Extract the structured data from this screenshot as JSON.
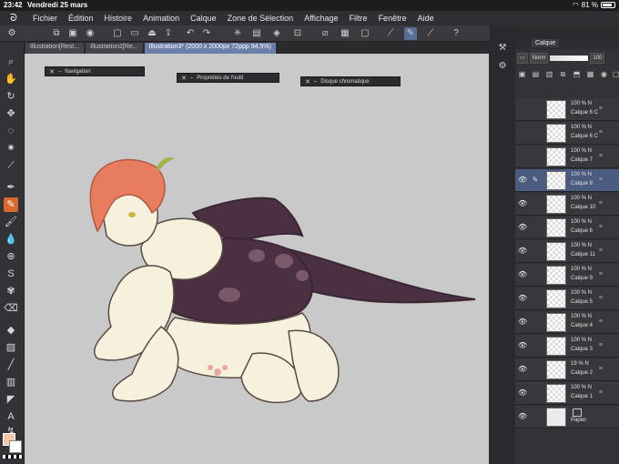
{
  "status": {
    "time": "23:42",
    "date": "Vendredi 25 mars",
    "battery": "81 %"
  },
  "menu": [
    "Fichier",
    "Édition",
    "Histoire",
    "Animation",
    "Calque",
    "Zone de Sélection",
    "Affichage",
    "Filtre",
    "Fenêtre",
    "Aide"
  ],
  "tabs": [
    {
      "label": "Illustration[Rest..."
    },
    {
      "label": "Illustration2[Re..."
    },
    {
      "label": "Illustration3* (2000 x 2000px 72ppp 94.5%)"
    }
  ],
  "palettes": {
    "navigation": "Navigation",
    "tool_props": "Propriétés de l'outil",
    "color_wheel": "Disque chromatique"
  },
  "layer_panel": {
    "tab": "Calque",
    "blend_mode": "Norm",
    "opacity": "100"
  },
  "layers": [
    {
      "opacity": "100 % N",
      "name": "Calque 6 C",
      "visible": false
    },
    {
      "opacity": "100 % N",
      "name": "Calque 6 C",
      "visible": false
    },
    {
      "opacity": "100 % N",
      "name": "Calque 7",
      "visible": false
    },
    {
      "opacity": "100 % N",
      "name": "Calque 8",
      "visible": true,
      "selected": true
    },
    {
      "opacity": "100 % N",
      "name": "Calque 10",
      "visible": true
    },
    {
      "opacity": "100 % N",
      "name": "Calque 6",
      "visible": true
    },
    {
      "opacity": "100 % N",
      "name": "Calque 11",
      "visible": true
    },
    {
      "opacity": "100 % N",
      "name": "Calque 9",
      "visible": true
    },
    {
      "opacity": "100 % N",
      "name": "Calque 5",
      "visible": true
    },
    {
      "opacity": "100 % N",
      "name": "Calque 4",
      "visible": true
    },
    {
      "opacity": "100 % N",
      "name": "Calque 3",
      "visible": true
    },
    {
      "opacity": "19 % N",
      "name": "Calque 2",
      "visible": true
    },
    {
      "opacity": "100 % N",
      "name": "Calque 1",
      "visible": true
    },
    {
      "opacity": "",
      "name": "Papier",
      "visible": true,
      "paper": true
    }
  ],
  "colors": {
    "foreground": "#f3c9a8",
    "background": "#ffffff",
    "accent": "#4b5c80",
    "selected_tool": "#d86a2f"
  }
}
